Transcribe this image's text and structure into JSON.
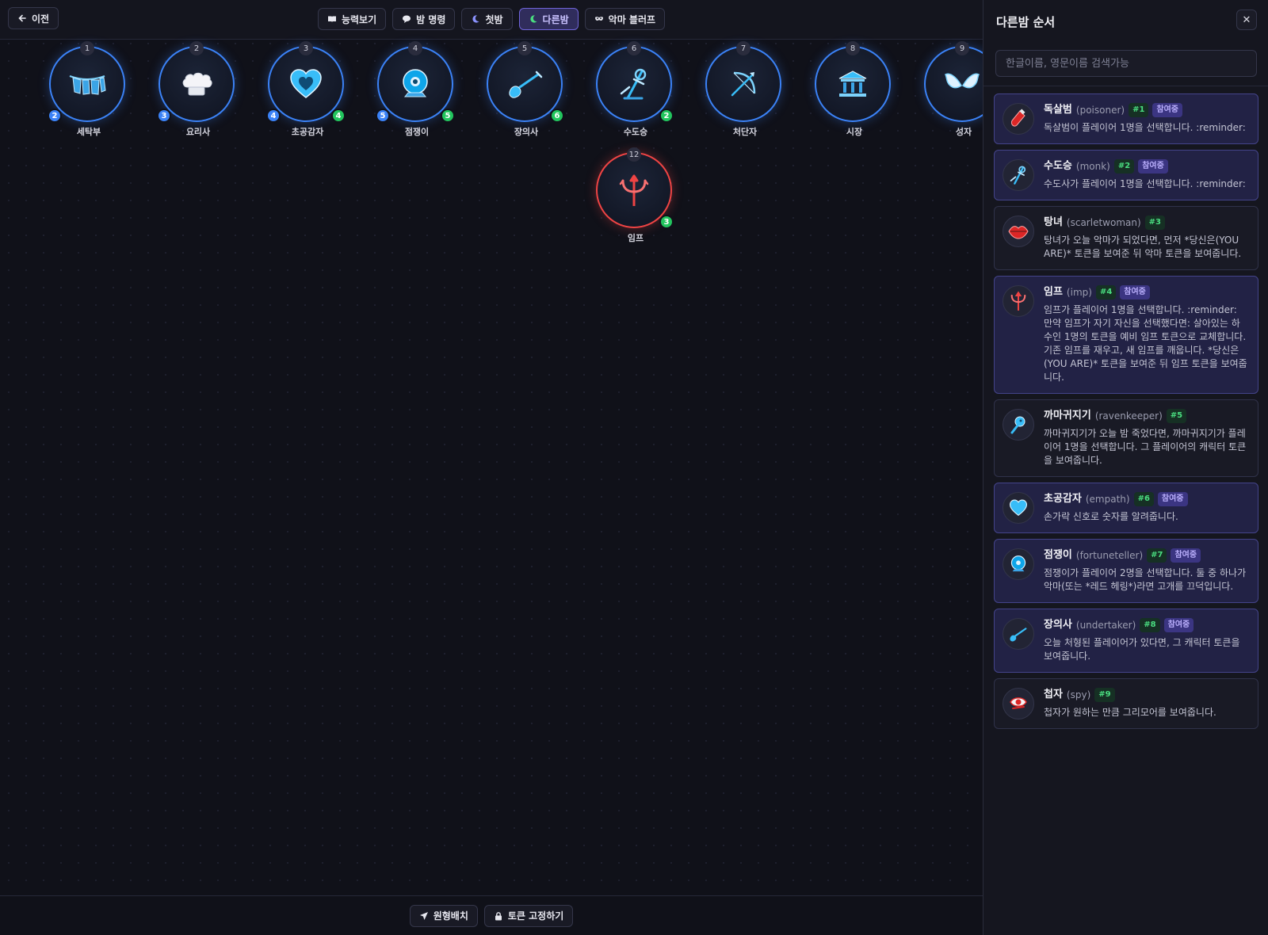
{
  "header": {
    "back_label": "이전",
    "tabs": [
      {
        "label": "능력보기",
        "active": false
      },
      {
        "label": "밤 명령",
        "active": false
      },
      {
        "label": "첫밤",
        "active": false
      },
      {
        "label": "다른밤",
        "active": true
      },
      {
        "label": "악마 블러프",
        "active": false
      }
    ]
  },
  "tokens": [
    {
      "seat": "1",
      "name": "세탁부",
      "icon": "laundry-line-icon",
      "badge_left": "2",
      "badge_right": ""
    },
    {
      "seat": "2",
      "name": "요리사",
      "icon": "chef-hat-icon",
      "badge_left": "3",
      "badge_right": ""
    },
    {
      "seat": "3",
      "name": "초공감자",
      "icon": "heart-icon",
      "badge_left": "4",
      "badge_right": "4"
    },
    {
      "seat": "4",
      "name": "점쟁이",
      "icon": "crystal-ball-icon",
      "badge_left": "5",
      "badge_right": "5"
    },
    {
      "seat": "5",
      "name": "장의사",
      "icon": "shovel-icon",
      "badge_left": "",
      "badge_right": "6"
    },
    {
      "seat": "6",
      "name": "수도승",
      "icon": "monk-staff-icon",
      "badge_left": "",
      "badge_right": "2"
    },
    {
      "seat": "7",
      "name": "처단자",
      "icon": "crossbow-icon",
      "badge_left": "",
      "badge_right": ""
    },
    {
      "seat": "8",
      "name": "시장",
      "icon": "town-hall-icon",
      "badge_left": "",
      "badge_right": ""
    },
    {
      "seat": "9",
      "name": "성자",
      "icon": "angel-wings-icon",
      "badge_left": "",
      "badge_right": ""
    },
    {
      "seat": "12",
      "name": "임프",
      "icon": "trident-icon",
      "badge_left": "",
      "badge_right": "3",
      "evil": true
    }
  ],
  "bottom": {
    "circle_label": "원형배치",
    "lock_label": "토큰 고정하기"
  },
  "panel": {
    "title": "다른밤 순서",
    "close_label": "✕",
    "search_placeholder": "한글이름, 영문이름 검색가능",
    "participating_label": "참여중",
    "items": [
      {
        "name": "독살범",
        "id": "(poisoner)",
        "num": "#1",
        "participating": true,
        "icon": "poison-bottle-icon",
        "desc": "독살범이 플레이어 1명을 선택합니다. :reminder:"
      },
      {
        "name": "수도승",
        "id": "(monk)",
        "num": "#2",
        "participating": true,
        "icon": "monk-staff-icon",
        "desc": "수도사가 플레이어 1명을 선택합니다. :reminder:"
      },
      {
        "name": "탕녀",
        "id": "(scarletwoman)",
        "num": "#3",
        "participating": false,
        "icon": "red-lips-icon",
        "desc": "탕녀가 오늘 악마가 되었다면, 먼저 *당신은(YOU ARE)* 토큰을 보여준 뒤 악마 토큰을 보여줍니다."
      },
      {
        "name": "임프",
        "id": "(imp)",
        "num": "#4",
        "participating": true,
        "icon": "trident-icon",
        "desc": "임프가 플레이어 1명을 선택합니다. :reminder: 만약 임프가 자기 자신을 선택했다면: 살아있는 하수인 1명의 토큰을 예비 임프 토큰으로 교체합니다. 기존 임프를 재우고, 새 임프를 깨웁니다. *당신은(YOU ARE)* 토큰을 보여준 뒤 임프 토큰을 보여줍니다."
      },
      {
        "name": "까마귀지기",
        "id": "(ravenkeeper)",
        "num": "#5",
        "participating": false,
        "icon": "raven-icon",
        "desc": "까마귀지기가 오늘 밤 죽었다면, 까마귀지기가 플레이어 1명을 선택합니다. 그 플레이어의 캐릭터 토큰을 보여줍니다."
      },
      {
        "name": "초공감자",
        "id": "(empath)",
        "num": "#6",
        "participating": true,
        "icon": "heart-icon",
        "desc": "손가락 신호로 숫자를 알려줍니다."
      },
      {
        "name": "점쟁이",
        "id": "(fortuneteller)",
        "num": "#7",
        "participating": true,
        "icon": "crystal-ball-icon",
        "desc": "점쟁이가 플레이어 2명을 선택합니다. 둘 중 하나가 악마(또는 *레드 헤링*)라면 고개를 끄덕입니다."
      },
      {
        "name": "장의사",
        "id": "(undertaker)",
        "num": "#8",
        "participating": true,
        "icon": "shovel-icon",
        "desc": "오늘 처형된 플레이어가 있다면, 그 캐릭터 토큰을 보여줍니다."
      },
      {
        "name": "첩자",
        "id": "(spy)",
        "num": "#9",
        "participating": false,
        "icon": "spy-icon",
        "desc": "첩자가 원하는 만큼 그리모어를 보여줍니다."
      }
    ]
  }
}
